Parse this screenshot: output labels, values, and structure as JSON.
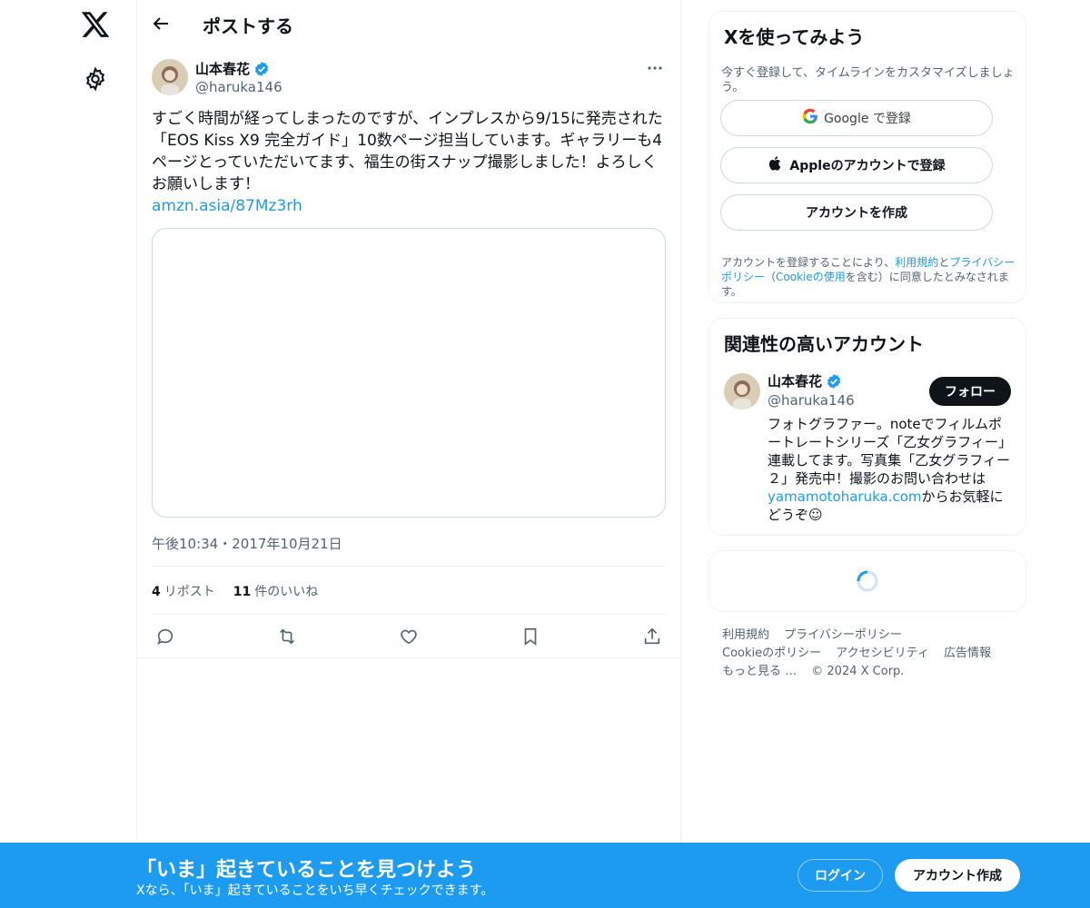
{
  "colors": {
    "accent": "#1d9bf0",
    "text": "#0f1419",
    "muted": "#536471",
    "border": "#cfd9de"
  },
  "nav": {
    "logo_icon": "x-logo-icon",
    "settings_icon": "gear-icon"
  },
  "header": {
    "title": "ポストする",
    "back_icon": "arrow-left-icon"
  },
  "post": {
    "author_name": "山本春花",
    "author_handle": "@haruka146",
    "text": "すごく時間が経ってしまったのですが、インプレスから9/15に発売された「EOS Kiss X9 完全ガイド」10数ページ担当しています。ギャラリーも4ページとっていただいてます、福生の街スナップ撮影しました！よろしくお願いします！",
    "link": "amzn.asia/87Mz3rh",
    "timestamp": "午後10:34・2017年10月21日",
    "reposts_count": "4",
    "reposts_label": "リポスト",
    "likes_count": "11",
    "likes_label": "件のいいね",
    "actions": [
      "reply-icon",
      "repost-icon",
      "like-icon",
      "bookmark-icon",
      "share-icon"
    ]
  },
  "signup": {
    "title": "Xを使ってみよう",
    "subtitle": "今すぐ登録して、タイムラインをカスタマイズしましょう。",
    "google_label": "Google で登録",
    "apple_label": "Appleのアカウントで登録",
    "create_label": "アカウントを作成",
    "terms_prefix": "アカウントを登録することにより、",
    "terms_link": "利用規約",
    "terms_and": "と",
    "privacy_link": "プライバシーポリシー",
    "terms_paren_open": "（",
    "cookie_link": "Cookieの使用",
    "terms_suffix": "を含む）に同意したとみなされます。"
  },
  "related": {
    "title": "関連性の高いアカウント",
    "name": "山本春花",
    "handle": "@haruka146",
    "follow_label": "フォロー",
    "bio_prefix": "フォトグラファー。noteでフィルムポートレートシリーズ「乙女グラフィー」連載してます。写真集「乙女グラフィー２」発売中！撮影のお問い合わせは",
    "bio_link": "yamamotoharuka.com",
    "bio_suffix": "からお気軽にどうぞ☺"
  },
  "footer": {
    "links": [
      "利用規約",
      "プライバシーポリシー",
      "Cookieのポリシー",
      "アクセシビリティ",
      "広告情報",
      "もっと見る …",
      "© 2024 X Corp."
    ]
  },
  "banner": {
    "title": "「いま」起きていることを見つけよう",
    "subtitle": "Xなら、「いま」起きていることをいち早くチェックできます。",
    "login_label": "ログイン",
    "signup_label": "アカウント作成"
  }
}
